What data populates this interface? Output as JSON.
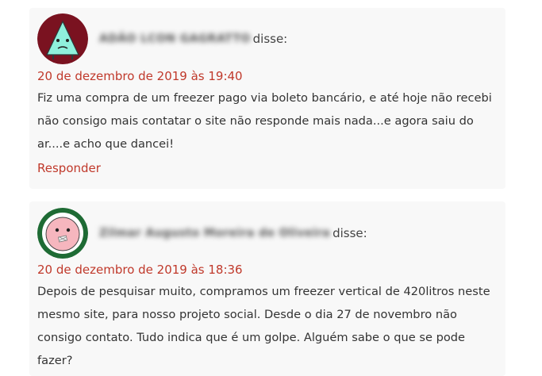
{
  "comments": [
    {
      "author": "ADÃO LCON GAGRATTO",
      "said_label": "disse:",
      "date": "20 de dezembro de 2019 às 19:40",
      "body": "Fiz uma compra de um freezer pago via boleto bancário, e até hoje não recebi não consigo mais contatar o site não responde mais nada...e agora saiu do ar....e acho que dancei!",
      "reply_label": "Responder",
      "avatar_icon": "triangle-monster-avatar"
    },
    {
      "author": "Zilmar Augusto Moreira de Oliveira",
      "said_label": "disse:",
      "date": "20 de dezembro de 2019 às 18:36",
      "body": "Depois de pesquisar muito, compramos um freezer vertical de 420litros neste mesmo site, para nosso projeto social. Desde o dia 27 de novembro não consigo contato. Tudo indica que é um golpe. Alguém sabe o que se pode fazer?",
      "avatar_icon": "pink-face-avatar"
    }
  ],
  "colors": {
    "accent": "#c0392b",
    "card_background": "#f8f8f8",
    "text": "#333333"
  }
}
